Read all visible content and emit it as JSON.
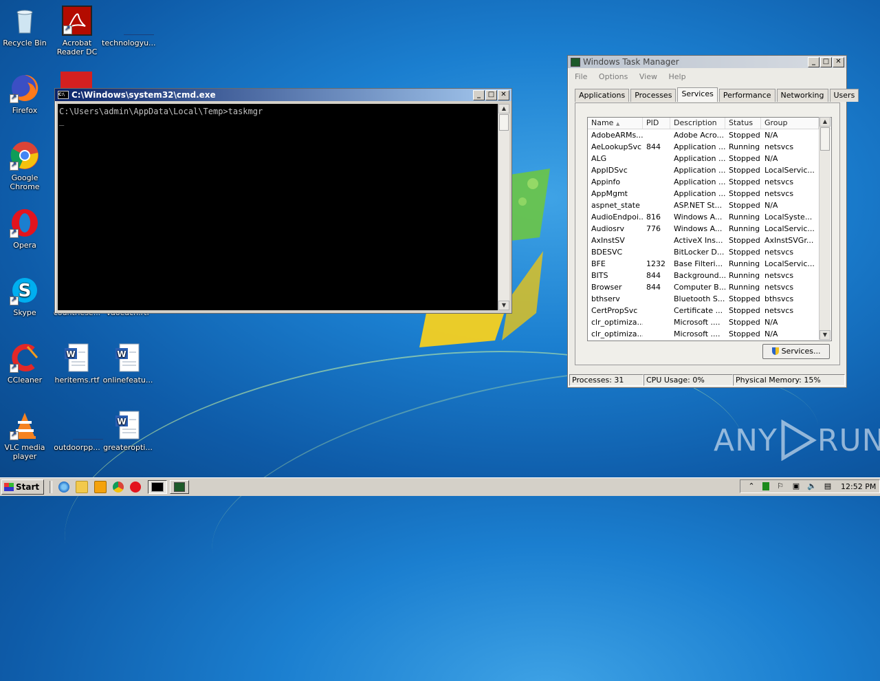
{
  "desktop_icons": [
    {
      "label": "Recycle Bin",
      "icon": "recycle-bin-icon"
    },
    {
      "label": "Acrobat Reader DC",
      "icon": "acrobat-icon"
    },
    {
      "label": "technologyu...",
      "icon": "file-icon"
    },
    {
      "label": "Firefox",
      "icon": "firefox-icon"
    },
    {
      "label": "Google Chrome",
      "icon": "chrome-icon"
    },
    {
      "label": "Opera",
      "icon": "opera-icon"
    },
    {
      "label": "Skype",
      "icon": "skype-icon"
    },
    {
      "label": "countriese...",
      "icon": "file-icon"
    },
    {
      "label": "vaoeach.rtf",
      "icon": "file-icon"
    },
    {
      "label": "CCleaner",
      "icon": "ccleaner-icon"
    },
    {
      "label": "heritems.rtf",
      "icon": "word-doc-icon"
    },
    {
      "label": "onlinefeatu...",
      "icon": "word-doc-icon"
    },
    {
      "label": "VLC media player",
      "icon": "vlc-icon"
    },
    {
      "label": "outdoorpp...",
      "icon": "file-icon"
    },
    {
      "label": "greateropti...",
      "icon": "word-doc-icon"
    }
  ],
  "cmd": {
    "title": "C:\\Windows\\system32\\cmd.exe",
    "line1": "C:\\Users\\admin\\AppData\\Local\\Temp>taskmgr",
    "cursor": "_"
  },
  "taskmgr": {
    "title": "Windows Task Manager",
    "menu": [
      "File",
      "Options",
      "View",
      "Help"
    ],
    "tabs": [
      "Applications",
      "Processes",
      "Services",
      "Performance",
      "Networking",
      "Users"
    ],
    "active_tab": "Services",
    "columns": [
      "Name",
      "PID",
      "Description",
      "Status",
      "Group"
    ],
    "rows": [
      [
        "AdobeARMs...",
        "",
        "Adobe Acro...",
        "Stopped",
        "N/A"
      ],
      [
        "AeLookupSvc",
        "844",
        "Application ...",
        "Running",
        "netsvcs"
      ],
      [
        "ALG",
        "",
        "Application ...",
        "Stopped",
        "N/A"
      ],
      [
        "AppIDSvc",
        "",
        "Application ...",
        "Stopped",
        "LocalServic..."
      ],
      [
        "Appinfo",
        "",
        "Application ...",
        "Stopped",
        "netsvcs"
      ],
      [
        "AppMgmt",
        "",
        "Application ...",
        "Stopped",
        "netsvcs"
      ],
      [
        "aspnet_state",
        "",
        "ASP.NET St...",
        "Stopped",
        "N/A"
      ],
      [
        "AudioEndpoi...",
        "816",
        "Windows A...",
        "Running",
        "LocalSyste..."
      ],
      [
        "Audiosrv",
        "776",
        "Windows A...",
        "Running",
        "LocalServic..."
      ],
      [
        "AxInstSV",
        "",
        "ActiveX Ins...",
        "Stopped",
        "AxInstSVGr..."
      ],
      [
        "BDESVC",
        "",
        "BitLocker D...",
        "Stopped",
        "netsvcs"
      ],
      [
        "BFE",
        "1232",
        "Base Filteri...",
        "Running",
        "LocalServic..."
      ],
      [
        "BITS",
        "844",
        "Background...",
        "Running",
        "netsvcs"
      ],
      [
        "Browser",
        "844",
        "Computer B...",
        "Running",
        "netsvcs"
      ],
      [
        "bthserv",
        "",
        "Bluetooth S...",
        "Stopped",
        "bthsvcs"
      ],
      [
        "CertPropSvc",
        "",
        "Certificate ...",
        "Stopped",
        "netsvcs"
      ],
      [
        "clr_optimiza...",
        "",
        "Microsoft ....",
        "Stopped",
        "N/A"
      ],
      [
        "clr_optimiza...",
        "",
        "Microsoft ....",
        "Stopped",
        "N/A"
      ]
    ],
    "services_button": "Services...",
    "status": {
      "processes": "Processes: 31",
      "cpu": "CPU Usage: 0%",
      "memory": "Physical Memory: 15%"
    }
  },
  "taskbar": {
    "start_label": "Start",
    "clock": "12:52 PM"
  },
  "watermark": {
    "left": "ANY",
    "right": "RUN"
  }
}
